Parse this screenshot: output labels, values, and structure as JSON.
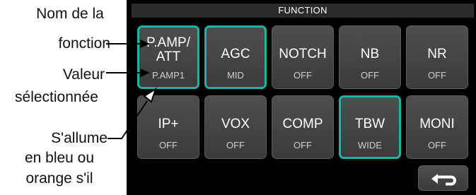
{
  "callouts": {
    "function_name": [
      "Nom de la",
      "fonction"
    ],
    "selected_value": [
      "Valeur",
      "sélectionnée"
    ],
    "lights_up": [
      "S'allume",
      "en bleu ou",
      "orange s'il"
    ]
  },
  "panel": {
    "title": "FUNCTION",
    "buttons": [
      {
        "name": "P.AMP/",
        "name2": "ATT",
        "value": "P.AMP1",
        "selected": true
      },
      {
        "name": "AGC",
        "value": "MID",
        "selected": true
      },
      {
        "name": "NOTCH",
        "value": "OFF",
        "selected": false
      },
      {
        "name": "NB",
        "value": "OFF",
        "selected": false
      },
      {
        "name": "NR",
        "value": "OFF",
        "selected": false
      },
      {
        "name": "IP+",
        "value": "OFF",
        "selected": false
      },
      {
        "name": "VOX",
        "value": "OFF",
        "selected": false
      },
      {
        "name": "COMP",
        "value": "OFF",
        "selected": false
      },
      {
        "name": "TBW",
        "value": "WIDE",
        "selected": true
      },
      {
        "name": "MONI",
        "value": "OFF",
        "selected": false
      }
    ],
    "back_icon": "return-arrow-icon"
  },
  "colors": {
    "selected_border": "#1cb3a8",
    "panel_bg": "#000000",
    "button_bg": "#444444"
  }
}
